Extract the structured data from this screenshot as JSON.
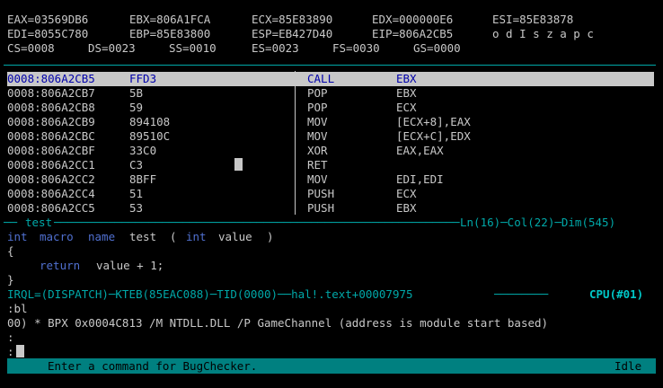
{
  "registers": {
    "row1": [
      "EAX=03569DB6",
      "EBX=806A1FCA",
      "ECX=85E83890",
      "EDX=000000E6",
      "ESI=85E83878"
    ],
    "row2": [
      "EDI=8055C780",
      "EBP=85E83800",
      "ESP=EB427D40",
      "EIP=806A2CB5",
      "o d I s z a p c"
    ],
    "row3": [
      "CS=0008",
      "DS=0023",
      "SS=0010",
      "ES=0023",
      "FS=0030",
      "GS=0000"
    ]
  },
  "disasm": [
    {
      "addr": "0008:806A2CB5",
      "bytes": "FFD3",
      "mnem": "CALL",
      "ops": "EBX"
    },
    {
      "addr": "0008:806A2CB7",
      "bytes": "5B",
      "mnem": "POP",
      "ops": "EBX"
    },
    {
      "addr": "0008:806A2CB8",
      "bytes": "59",
      "mnem": "POP",
      "ops": "ECX"
    },
    {
      "addr": "0008:806A2CB9",
      "bytes": "894108",
      "mnem": "MOV",
      "ops": "[ECX+8],EAX"
    },
    {
      "addr": "0008:806A2CBC",
      "bytes": "89510C",
      "mnem": "MOV",
      "ops": "[ECX+C],EDX"
    },
    {
      "addr": "0008:806A2CBF",
      "bytes": "33C0",
      "mnem": "XOR",
      "ops": "EAX,EAX"
    },
    {
      "addr": "0008:806A2CC1",
      "bytes": "C3",
      "mnem": "RET",
      "ops": ""
    },
    {
      "addr": "0008:806A2CC2",
      "bytes": "8BFF",
      "mnem": "MOV",
      "ops": "EDI,EDI"
    },
    {
      "addr": "0008:806A2CC4",
      "bytes": "51",
      "mnem": "PUSH",
      "ops": "ECX"
    },
    {
      "addr": "0008:806A2CC5",
      "bytes": "53",
      "mnem": "PUSH",
      "ops": "EBX"
    }
  ],
  "editor": {
    "name": "test",
    "status": "Ln(16)─Col(22)─Dim(545)",
    "line1": {
      "kw1": "int",
      "kw2": "macro",
      "kw3": "name",
      "name": "test",
      "p1": "(",
      "kw4": "int",
      "arg": "value",
      "p2": ")"
    },
    "line2": "{",
    "line3": {
      "kw": "return",
      "rest": "value + 1;"
    },
    "line4": "}"
  },
  "context": {
    "left": "IRQL=(DISPATCH)─KTEB(85EAC088)─TID(0000)──hal!.text+00007975",
    "cpu": "CPU(#01)"
  },
  "command": {
    "line1": ":bl",
    "line2": "00) * BPX 0x0004C813 /M NTDLL.DLL /P GameChannel (address is module start based)",
    "line3": ":",
    "prompt": ":"
  },
  "status": {
    "message": "Enter a command for BugChecker.",
    "state": "Idle"
  },
  "colors": {
    "background": "#000000",
    "text": "#c8c8c8",
    "accent": "#00a8a8",
    "highlight": "#c8c8c8",
    "statusbar": "#008080",
    "keyword": "#5070d0"
  }
}
